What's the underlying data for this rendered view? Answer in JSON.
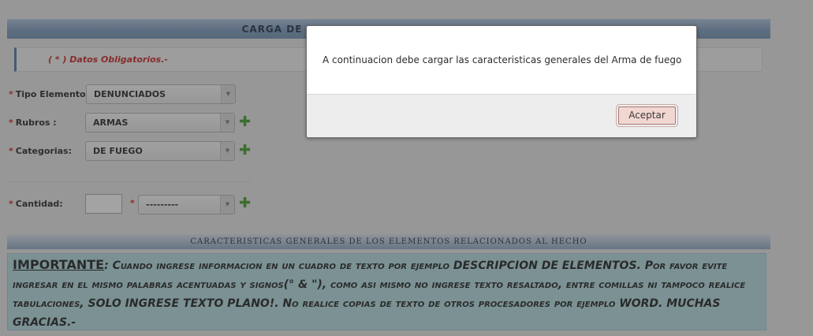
{
  "page": {
    "title": "CARGA DE",
    "required_note": "( * ) Datos Obligatorios.-",
    "fields": {
      "tipo_elemento": {
        "label": "Tipo Elemento :",
        "value": "DENUNCIADOS"
      },
      "rubros": {
        "label": "Rubros :",
        "value": "ARMAS"
      },
      "categorias": {
        "label": "Categorias:",
        "value": "DE FUEGO"
      },
      "cantidad": {
        "label": "Cantidad:",
        "unit_value": "---------"
      }
    },
    "asterisk": "*",
    "section_title": "CARACTERISTICAS GENERALES DE LOS ELEMENTOS RELACIONADOS AL HECHO",
    "important_heading": "IMPORTANTE",
    "important_text": ": Cuando ingrese informacion en un cuadro de texto por ejemplo DESCRIPCION DE ELEMENTOS. Por favor evite ingresar en el mismo palabras acentuadas y signos(° & \"), como asi mismo no ingrese texto resaltado, entre comillas ni tampoco realice tabulaciones, SOLO INGRESE TEXTO PLANO!. No realice copias de texto de otros procesadores por ejemplo WORD. MUCHAS GRACIAS.-"
  },
  "dialog": {
    "message": "A continuacion debe cargar las caracteristicas generales del Arma de fuego",
    "ok_label": "Aceptar"
  },
  "icons": {
    "add": "plus-icon",
    "dropdown": "chevron-down-icon"
  },
  "colors": {
    "required": "#cc1f1f",
    "add_icon": "#3d9b27",
    "header_blue": "#6e8fb5",
    "notice_bg": "#b4dde2"
  }
}
